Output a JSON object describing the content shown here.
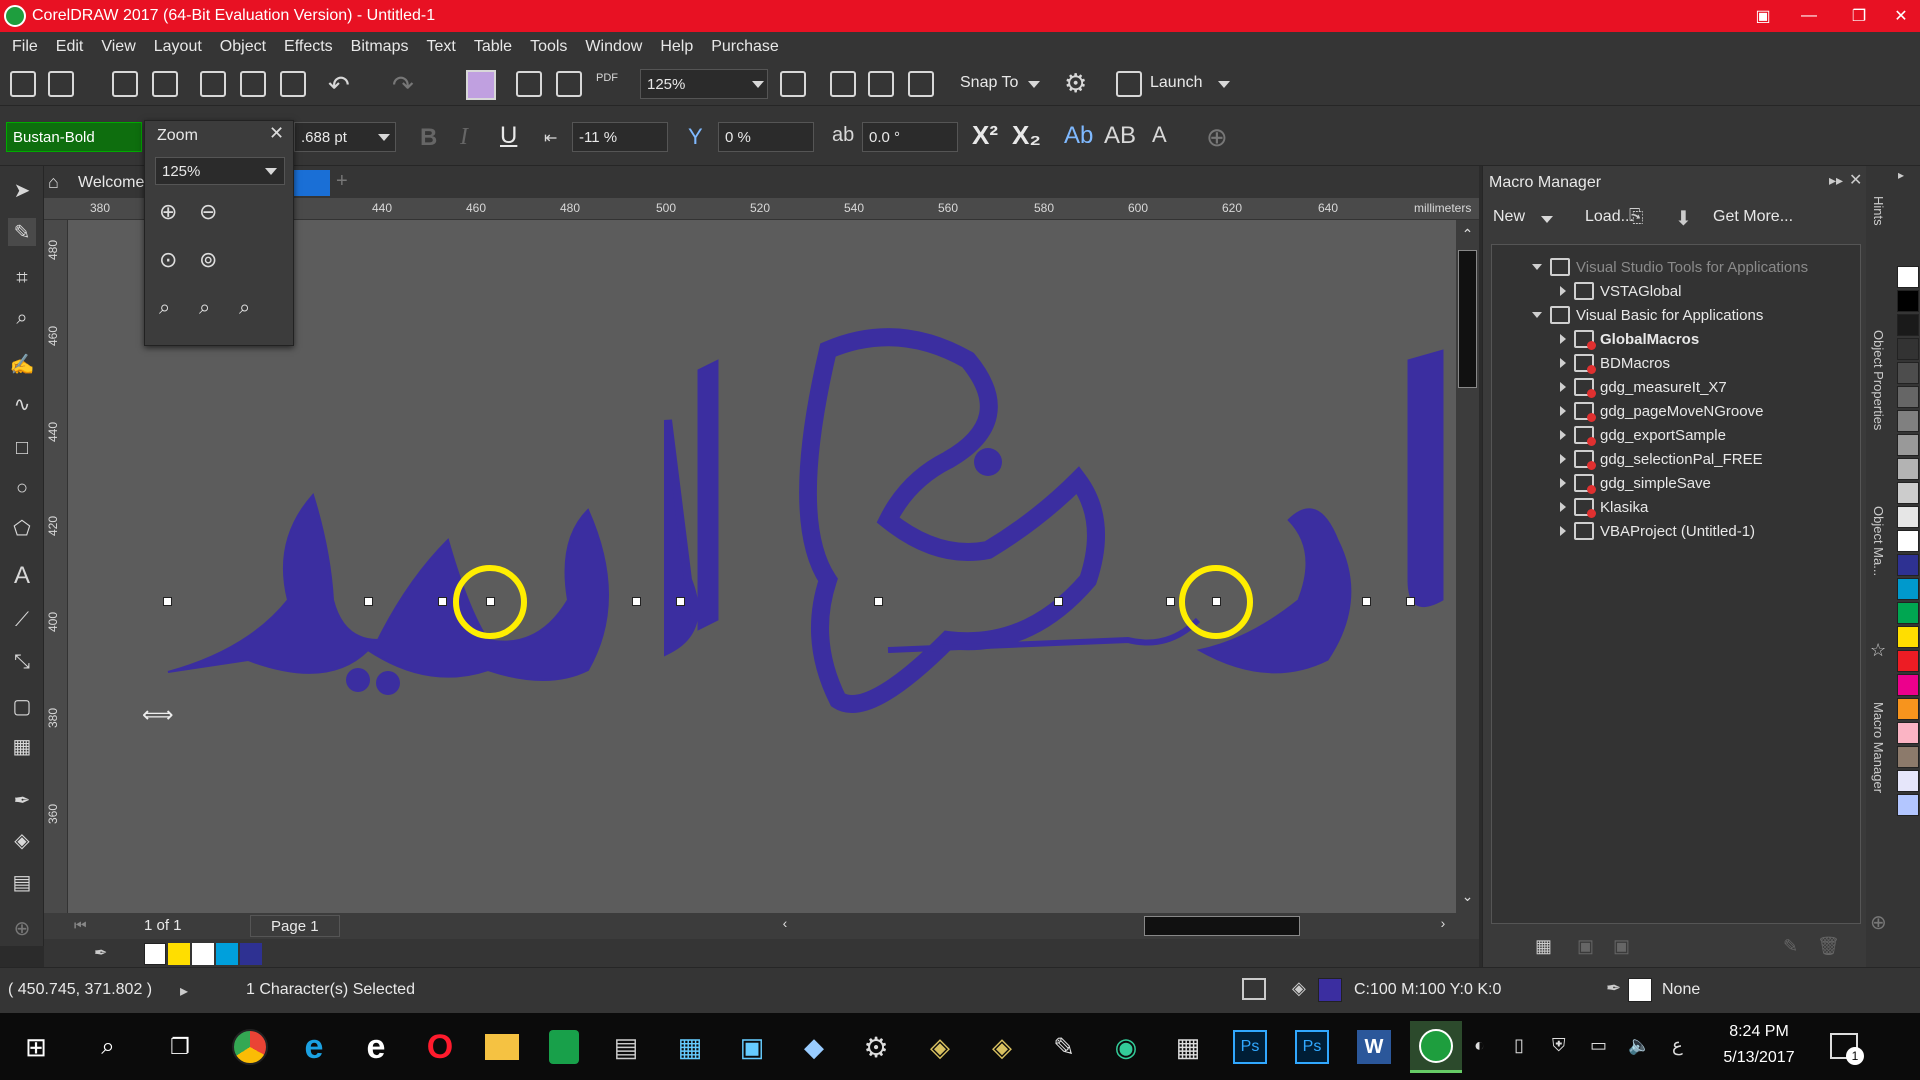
{
  "window": {
    "title": "CorelDRAW 2017 (64-Bit Evaluation Version) - Untitled-1"
  },
  "menu": [
    "File",
    "Edit",
    "View",
    "Layout",
    "Object",
    "Effects",
    "Bitmaps",
    "Text",
    "Table",
    "Tools",
    "Window",
    "Help",
    "Purchase"
  ],
  "std_toolbar": {
    "zoom_value": "125%",
    "snap_label": "Snap To",
    "launch_label": "Launch"
  },
  "property_bar": {
    "font_name": "Bustan-Bold",
    "font_size": ".688 pt",
    "char_spacing": "-11 %",
    "baseline_shift": "0 %",
    "char_angle": "0.0 °"
  },
  "zoom_popup": {
    "title": "Zoom",
    "value": "125%"
  },
  "doc_tab": {
    "label": "Welcome"
  },
  "ruler": {
    "h_ticks": [
      "380",
      "440",
      "460",
      "480",
      "500",
      "520",
      "540",
      "560",
      "580",
      "600",
      "620",
      "640"
    ],
    "unit": "millimeters",
    "v_ticks": [
      "480",
      "460",
      "440",
      "420",
      "400",
      "380",
      "360"
    ]
  },
  "page_nav": {
    "counter": "1 of 1",
    "page_tab": "Page 1"
  },
  "docker": {
    "title": "Macro Manager",
    "toolbar": {
      "new": "New",
      "load": "Load...",
      "get_more": "Get More..."
    },
    "tree": [
      {
        "label": "Visual Studio Tools for Applications",
        "level": 0,
        "expanded": true,
        "dim": true
      },
      {
        "label": "VSTAGlobal",
        "level": 1
      },
      {
        "label": "Visual Basic for Applications",
        "level": 0,
        "expanded": true
      },
      {
        "label": "GlobalMacros",
        "level": 1,
        "bold": true
      },
      {
        "label": "BDMacros",
        "level": 1
      },
      {
        "label": "gdg_measureIt_X7",
        "level": 1
      },
      {
        "label": "gdg_pageMoveNGroove",
        "level": 1
      },
      {
        "label": "gdg_exportSample",
        "level": 1
      },
      {
        "label": "gdg_selectionPal_FREE",
        "level": 1
      },
      {
        "label": "gdg_simpleSave",
        "level": 1
      },
      {
        "label": "Klasika",
        "level": 1
      },
      {
        "label": "VBAProject (Untitled-1)",
        "level": 1
      }
    ],
    "side_tabs": [
      "Hints",
      "Object Properties",
      "Object Ma...",
      "Macro Manager"
    ]
  },
  "status": {
    "coords": "( 450.745, 371.802 )",
    "selection": "1 Character(s) Selected",
    "fill_info": "C:100 M:100 Y:0 K:0",
    "outline": "None"
  },
  "colors": {
    "accent_title": "#e81123",
    "text_fill": "#3b2ea0",
    "highlight": "#ffee00"
  },
  "palette": [
    "#ffffff",
    "#000000",
    "#1a1a1a",
    "#333333",
    "#4d4d4d",
    "#666666",
    "#808080",
    "#999999",
    "#b3b3b3",
    "#cccccc",
    "#e6e6e6",
    "#ffffff",
    "#2e3192",
    "#0099cc",
    "#00a651",
    "#ffde00",
    "#ed1c24",
    "#ec008c",
    "#f7941d",
    "#fbb4c4",
    "#8c7a6b",
    "#e6e6fa",
    "#b3c6ff"
  ],
  "taskbar": {
    "time": "8:24 PM",
    "date": "5/13/2017",
    "notif_count": "1",
    "lang": "ع"
  }
}
